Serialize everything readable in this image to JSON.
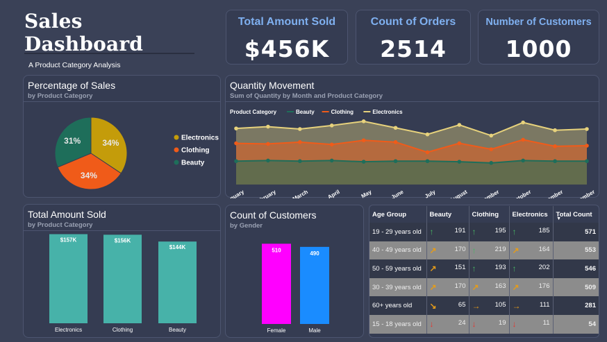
{
  "header": {
    "title": "Sales Dashboard",
    "subtitle": "A Product Category Analysis"
  },
  "kpis": [
    {
      "label": "Total Amount Sold",
      "value": "$456K"
    },
    {
      "label": "Count of Orders",
      "value": "2514"
    },
    {
      "label": "Number of Customers",
      "value": "1000"
    }
  ],
  "pie_panel": {
    "title": "Percentage of Sales",
    "subtitle": "by Product Category"
  },
  "line_panel": {
    "title": "Quantity Movement",
    "subtitle": "Sum of Quantity by Month and Product Category"
  },
  "bar_panel": {
    "title": "Total Amount Sold",
    "subtitle": "by Product Category"
  },
  "gender_panel": {
    "title": "Count of Customers",
    "subtitle": "by Gender"
  },
  "chart_data": [
    {
      "type": "pie",
      "labels": [
        "Electronics",
        "Clothing",
        "Beauty"
      ],
      "values": [
        34,
        34,
        31
      ],
      "value_labels": [
        "34%",
        "34%",
        "31%"
      ],
      "colors": [
        "#c49c0a",
        "#f05b19",
        "#1e6e5a"
      ],
      "legend": "right"
    },
    {
      "type": "area",
      "legend_title": "Product Category",
      "categories": [
        "January",
        "February",
        "March",
        "April",
        "May",
        "June",
        "July",
        "August",
        "September",
        "October",
        "November",
        "December"
      ],
      "series": [
        {
          "name": "Beauty",
          "color": "#1e6e5a",
          "values": [
            60,
            61,
            60,
            61,
            59,
            60,
            60,
            59,
            57,
            61,
            60,
            60
          ]
        },
        {
          "name": "Clothing",
          "color": "#f05b19",
          "values": [
            90,
            89,
            92,
            88,
            95,
            92,
            75,
            90,
            80,
            96,
            85,
            86
          ]
        },
        {
          "name": "Electronics",
          "color": "#e7d27c",
          "values": [
            115,
            118,
            114,
            120,
            127,
            116,
            105,
            121,
            103,
            125,
            112,
            114
          ]
        }
      ]
    },
    {
      "type": "bar",
      "categories": [
        "Electronics",
        "Clothing",
        "Beauty"
      ],
      "values": [
        157,
        156,
        144
      ],
      "value_labels": [
        "$157K",
        "$156K",
        "$144K"
      ],
      "color": "#47b2a9",
      "ylim": [
        0,
        165
      ]
    },
    {
      "type": "bar",
      "categories": [
        "Female",
        "Male"
      ],
      "values": [
        510,
        490
      ],
      "value_labels": [
        "510",
        "490"
      ],
      "colors": [
        "#ff00ff",
        "#1a8cff"
      ],
      "ylim": [
        0,
        560
      ]
    }
  ],
  "age_table": {
    "headers": [
      "Age Group",
      "Beauty",
      "Clothing",
      "Electronics",
      "Total Count"
    ],
    "rows": [
      {
        "age": "19 - 29 years old",
        "b": "191",
        "bi": "up",
        "c": "195",
        "ci": "up",
        "e": "185",
        "ei": "up",
        "total": "571",
        "shade": "dark"
      },
      {
        "age": "40 - 49 years old",
        "b": "170",
        "bi": "upright",
        "c": "219",
        "ci": "up",
        "e": "164",
        "ei": "upright",
        "total": "553",
        "shade": "light"
      },
      {
        "age": "50 - 59 years old",
        "b": "151",
        "bi": "upright",
        "c": "193",
        "ci": "up",
        "e": "202",
        "ei": "up",
        "total": "546",
        "shade": "dark"
      },
      {
        "age": "30 - 39 years old",
        "b": "170",
        "bi": "upright",
        "c": "163",
        "ci": "upright",
        "e": "176",
        "ei": "upright",
        "total": "509",
        "shade": "light"
      },
      {
        "age": "60+ years old",
        "b": "65",
        "bi": "downright",
        "c": "105",
        "ci": "right",
        "e": "111",
        "ei": "right",
        "total": "281",
        "shade": "dark"
      },
      {
        "age": "15 - 18 years old",
        "b": "24",
        "bi": "down",
        "c": "19",
        "ci": "down",
        "e": "11",
        "ei": "down",
        "total": "54",
        "shade": "light"
      }
    ]
  }
}
